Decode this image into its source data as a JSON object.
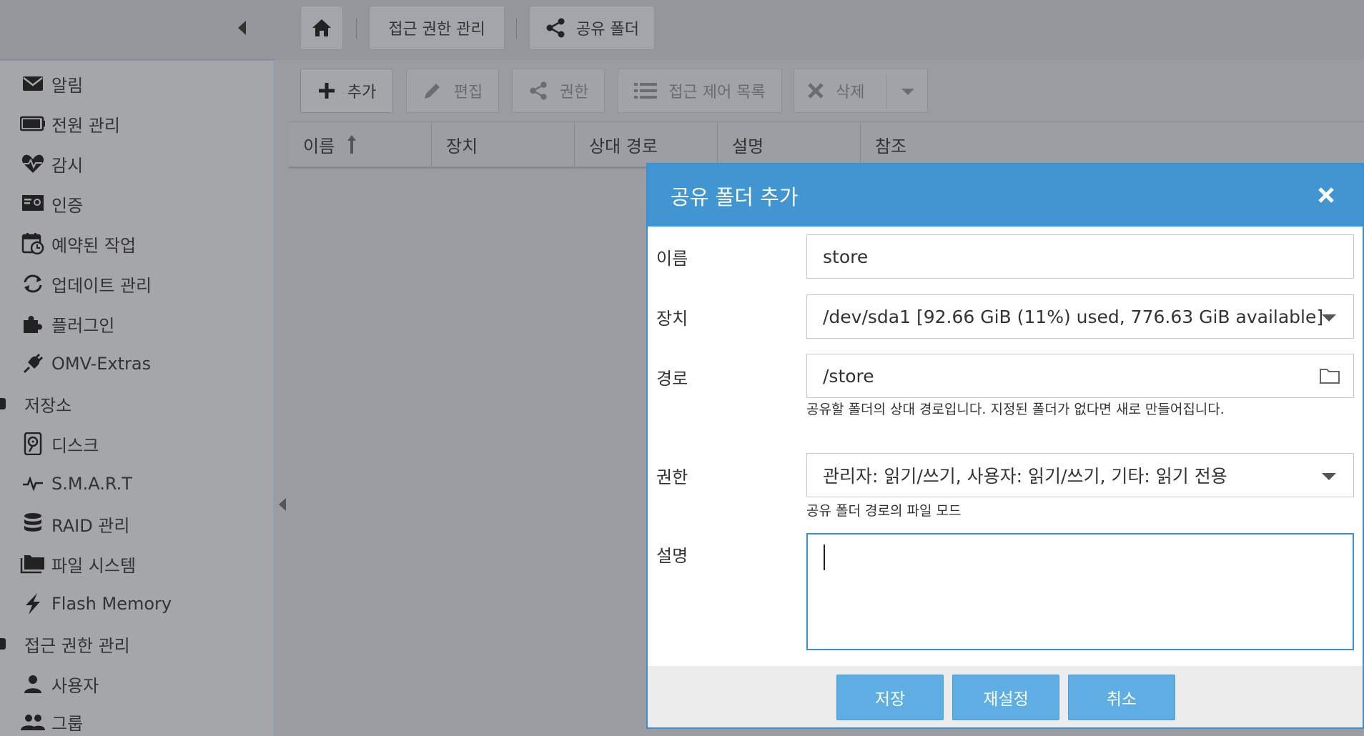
{
  "breadcrumb": {
    "home_icon": "home-icon",
    "item1": "접근 권한 관리",
    "item2": "공유 폴더",
    "item2_icon": "share-icon"
  },
  "sidebar": {
    "items": [
      {
        "label": "알림",
        "icon": "envelope-icon"
      },
      {
        "label": "전원 관리",
        "icon": "battery-icon"
      },
      {
        "label": "감시",
        "icon": "heartbeat-icon"
      },
      {
        "label": "인증",
        "icon": "certificate-icon"
      },
      {
        "label": "예약된 작업",
        "icon": "calendar-clock-icon"
      },
      {
        "label": "업데이트 관리",
        "icon": "refresh-icon"
      },
      {
        "label": "플러그인",
        "icon": "puzzle-icon"
      },
      {
        "label": "OMV-Extras",
        "icon": "plug-icon"
      }
    ],
    "group_storage": "저장소",
    "storage_items": [
      {
        "label": "디스크",
        "icon": "harddisk-icon"
      },
      {
        "label": "S.M.A.R.T",
        "icon": "pulse-icon"
      },
      {
        "label": "RAID 관리",
        "icon": "database-icon"
      },
      {
        "label": "파일 시스템",
        "icon": "folders-icon"
      },
      {
        "label": "Flash Memory",
        "icon": "flash-icon"
      }
    ],
    "group_access": "접근 권한 관리",
    "access_items": [
      {
        "label": "사용자",
        "icon": "user-icon"
      },
      {
        "label": "그룹",
        "icon": "group-icon"
      }
    ]
  },
  "toolbar": {
    "add": "추가",
    "edit": "편집",
    "permissions": "권한",
    "acl": "접근 제어 목록",
    "delete": "삭제"
  },
  "grid": {
    "columns": [
      "이름",
      "장치",
      "상대 경로",
      "설명",
      "참조"
    ]
  },
  "dialog": {
    "title": "공유 폴더 추가",
    "fields": {
      "name_label": "이름",
      "name_value": "store",
      "device_label": "장치",
      "device_value": "/dev/sda1 [92.66 GiB (11%) used, 776.63 GiB available]",
      "path_label": "경로",
      "path_value": "/store",
      "path_hint": "공유할 폴더의 상대 경로입니다. 지정된 폴더가 없다면 새로 만들어집니다.",
      "perm_label": "권한",
      "perm_value": "관리자: 읽기/쓰기, 사용자: 읽기/쓰기, 기타: 읽기 전용",
      "perm_hint": "공유 폴더 경로의 파일 모드",
      "desc_label": "설명",
      "desc_value": ""
    },
    "buttons": {
      "save": "저장",
      "reset": "재설정",
      "cancel": "취소"
    }
  },
  "colors": {
    "dialog_header": "#4196d1",
    "button": "#5eaee3",
    "focus_border": "#3c8fd1"
  }
}
